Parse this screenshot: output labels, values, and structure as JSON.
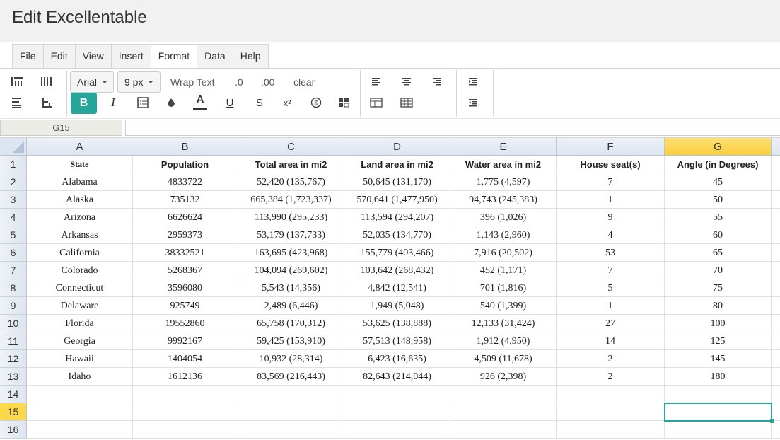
{
  "app": {
    "title": "Edit Excellentable"
  },
  "menu": {
    "items": [
      "File",
      "Edit",
      "View",
      "Insert",
      "Format",
      "Data",
      "Help"
    ],
    "active": "Format"
  },
  "toolbar": {
    "font_family": "Arial",
    "font_size": "9 px",
    "wrap_text_label": "Wrap Text",
    "decimal_decrease_label": ".0",
    "decimal_increase_label": ".00",
    "clear_label": "clear",
    "bold_label": "B",
    "italic_label": "I",
    "underline_label": "U",
    "strike_label": "S",
    "superscript_label": "x²",
    "font_color_label": "A",
    "accent_color": "#26a69a"
  },
  "formula_bar": {
    "cell_ref": "G15",
    "formula": ""
  },
  "sheet": {
    "columns": [
      "A",
      "B",
      "C",
      "D",
      "E",
      "F",
      "G"
    ],
    "selected_column": "G",
    "selected_row": "15",
    "row_numbers": [
      "1",
      "2",
      "3",
      "4",
      "5",
      "6",
      "7",
      "8",
      "9",
      "10",
      "11",
      "12",
      "13",
      "14",
      "15",
      "16"
    ],
    "rows": [
      [
        "State",
        "Population",
        "Total area in mi2",
        "Land area in mi2",
        "Water area in mi2",
        "House seat(s)",
        "Angle (in Degrees)"
      ],
      [
        "Alabama",
        "4833722",
        "52,420 (135,767)",
        "50,645 (131,170)",
        "1,775 (4,597)",
        "7",
        "45"
      ],
      [
        "Alaska",
        "735132",
        "665,384 (1,723,337)",
        "570,641 (1,477,950)",
        "94,743 (245,383)",
        "1",
        "50"
      ],
      [
        "Arizona",
        "6626624",
        "113,990 (295,233)",
        "113,594 (294,207)",
        "396 (1,026)",
        "9",
        "55"
      ],
      [
        "Arkansas",
        "2959373",
        "53,179 (137,733)",
        "52,035 (134,770)",
        "1,143 (2,960)",
        "4",
        "60"
      ],
      [
        "California",
        "38332521",
        "163,695 (423,968)",
        "155,779 (403,466)",
        "7,916 (20,502)",
        "53",
        "65"
      ],
      [
        "Colorado",
        "5268367",
        "104,094 (269,602)",
        "103,642 (268,432)",
        "452 (1,171)",
        "7",
        "70"
      ],
      [
        "Connecticut",
        "3596080",
        "5,543 (14,356)",
        "4,842 (12,541)",
        "701 (1,816)",
        "5",
        "75"
      ],
      [
        "Delaware",
        "925749",
        "2,489 (6,446)",
        "1,949 (5,048)",
        "540 (1,399)",
        "1",
        "80"
      ],
      [
        "Florida",
        "19552860",
        "65,758 (170,312)",
        "53,625 (138,888)",
        "12,133 (31,424)",
        "27",
        "100"
      ],
      [
        "Georgia",
        "9992167",
        "59,425 (153,910)",
        "57,513 (148,958)",
        "1,912 (4,950)",
        "14",
        "125"
      ],
      [
        "Hawaii",
        "1404054",
        "10,932 (28,314)",
        "6,423 (16,635)",
        "4,509 (11,678)",
        "2",
        "145"
      ],
      [
        "Idaho",
        "1612136",
        "83,569 (216,443)",
        "82,643 (214,044)",
        "926 (2,398)",
        "2",
        "180"
      ],
      [
        "",
        "",
        "",
        "",
        "",
        "",
        ""
      ],
      [
        "",
        "",
        "",
        "",
        "",
        "",
        ""
      ],
      [
        "",
        "",
        "",
        "",
        "",
        "",
        ""
      ]
    ]
  }
}
